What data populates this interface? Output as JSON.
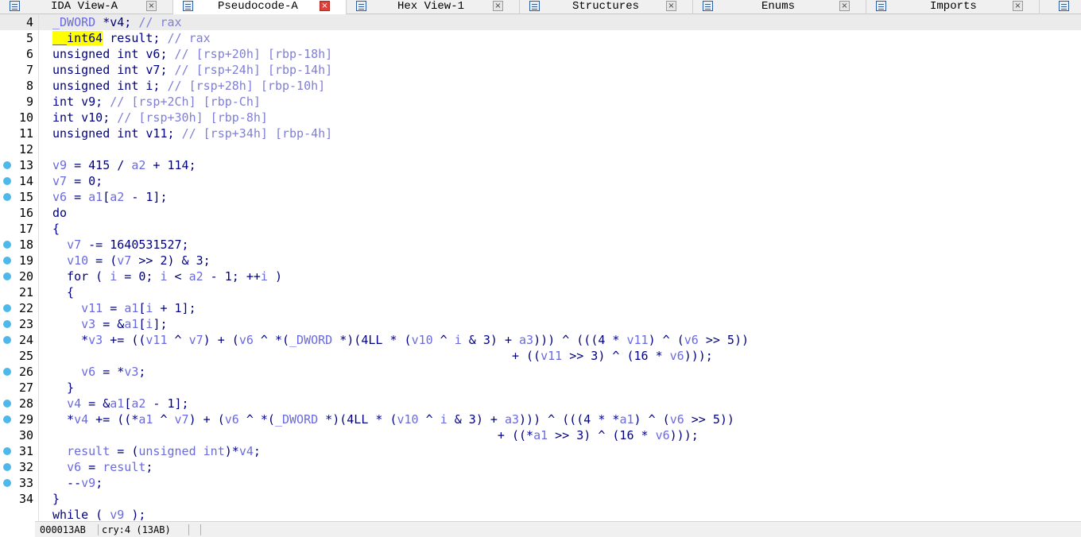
{
  "tabs": [
    {
      "label": "IDA View-A",
      "active": false,
      "icon": "listing-icon"
    },
    {
      "label": "Pseudocode-A",
      "active": true,
      "icon": "pseudocode-icon"
    },
    {
      "label": "Hex View-1",
      "active": false,
      "icon": "hex-icon"
    },
    {
      "label": "Structures",
      "active": false,
      "icon": "structures-icon"
    },
    {
      "label": "Enums",
      "active": false,
      "icon": "enums-icon"
    },
    {
      "label": "Imports",
      "active": false,
      "icon": "imports-icon"
    },
    {
      "label": "",
      "active": false,
      "icon": "exports-icon"
    }
  ],
  "code_lines": [
    {
      "num": "4",
      "bp": false,
      "tokens": [
        [
          "var",
          "_DWORD "
        ],
        [
          "kw",
          "*v4; "
        ],
        [
          "cmt",
          "// rax"
        ]
      ]
    },
    {
      "num": "5",
      "bp": false,
      "tokens": [
        [
          "hl",
          "__int64"
        ],
        [
          "kw",
          " result; "
        ],
        [
          "cmt",
          "// rax"
        ]
      ]
    },
    {
      "num": "6",
      "bp": false,
      "tokens": [
        [
          "kw",
          "unsigned int v6; "
        ],
        [
          "cmt",
          "// [rsp+20h] [rbp-18h]"
        ]
      ]
    },
    {
      "num": "7",
      "bp": false,
      "tokens": [
        [
          "kw",
          "unsigned int v7; "
        ],
        [
          "cmt",
          "// [rsp+24h] [rbp-14h]"
        ]
      ]
    },
    {
      "num": "8",
      "bp": false,
      "tokens": [
        [
          "kw",
          "unsigned int i; "
        ],
        [
          "cmt",
          "// [rsp+28h] [rbp-10h]"
        ]
      ]
    },
    {
      "num": "9",
      "bp": false,
      "tokens": [
        [
          "kw",
          "int v9; "
        ],
        [
          "cmt",
          "// [rsp+2Ch] [rbp-Ch]"
        ]
      ]
    },
    {
      "num": "10",
      "bp": false,
      "tokens": [
        [
          "kw",
          "int v10; "
        ],
        [
          "cmt",
          "// [rsp+30h] [rbp-8h]"
        ]
      ]
    },
    {
      "num": "11",
      "bp": false,
      "tokens": [
        [
          "kw",
          "unsigned int v11; "
        ],
        [
          "cmt",
          "// [rsp+34h] [rbp-4h]"
        ]
      ]
    },
    {
      "num": "12",
      "bp": false,
      "tokens": []
    },
    {
      "num": "13",
      "bp": true,
      "tokens": [
        [
          "var",
          "v9"
        ],
        [
          "kw",
          " = 415 / "
        ],
        [
          "var",
          "a2"
        ],
        [
          "kw",
          " + 114;"
        ]
      ]
    },
    {
      "num": "14",
      "bp": true,
      "tokens": [
        [
          "var",
          "v7"
        ],
        [
          "kw",
          " = 0;"
        ]
      ]
    },
    {
      "num": "15",
      "bp": true,
      "tokens": [
        [
          "var",
          "v6"
        ],
        [
          "kw",
          " = "
        ],
        [
          "var",
          "a1"
        ],
        [
          "kw",
          "["
        ],
        [
          "var",
          "a2"
        ],
        [
          "kw",
          " - 1];"
        ]
      ]
    },
    {
      "num": "16",
      "bp": false,
      "tokens": [
        [
          "kw",
          "do"
        ]
      ]
    },
    {
      "num": "17",
      "bp": false,
      "tokens": [
        [
          "kw",
          "{"
        ]
      ]
    },
    {
      "num": "18",
      "bp": true,
      "tokens": [
        [
          "kw",
          "  "
        ],
        [
          "var",
          "v7"
        ],
        [
          "kw",
          " -= 1640531527;"
        ]
      ]
    },
    {
      "num": "19",
      "bp": true,
      "tokens": [
        [
          "kw",
          "  "
        ],
        [
          "var",
          "v10"
        ],
        [
          "kw",
          " = ("
        ],
        [
          "var",
          "v7"
        ],
        [
          "kw",
          " >> 2) & 3;"
        ]
      ]
    },
    {
      "num": "20",
      "bp": true,
      "tokens": [
        [
          "kw",
          "  for ( "
        ],
        [
          "var",
          "i"
        ],
        [
          "kw",
          " = 0; "
        ],
        [
          "var",
          "i"
        ],
        [
          "kw",
          " < "
        ],
        [
          "var",
          "a2"
        ],
        [
          "kw",
          " - 1; ++"
        ],
        [
          "var",
          "i"
        ],
        [
          "kw",
          " )"
        ]
      ]
    },
    {
      "num": "21",
      "bp": false,
      "tokens": [
        [
          "kw",
          "  {"
        ]
      ]
    },
    {
      "num": "22",
      "bp": true,
      "tokens": [
        [
          "kw",
          "    "
        ],
        [
          "var",
          "v11"
        ],
        [
          "kw",
          " = "
        ],
        [
          "var",
          "a1"
        ],
        [
          "kw",
          "["
        ],
        [
          "var",
          "i"
        ],
        [
          "kw",
          " + 1];"
        ]
      ]
    },
    {
      "num": "23",
      "bp": true,
      "tokens": [
        [
          "kw",
          "    "
        ],
        [
          "var",
          "v3"
        ],
        [
          "kw",
          " = &"
        ],
        [
          "var",
          "a1"
        ],
        [
          "kw",
          "["
        ],
        [
          "var",
          "i"
        ],
        [
          "kw",
          "];"
        ]
      ]
    },
    {
      "num": "24",
      "bp": true,
      "tokens": [
        [
          "kw",
          "    *"
        ],
        [
          "var",
          "v3"
        ],
        [
          "kw",
          " += (("
        ],
        [
          "var",
          "v11"
        ],
        [
          "kw",
          " ^ "
        ],
        [
          "var",
          "v7"
        ],
        [
          "kw",
          ") + ("
        ],
        [
          "var",
          "v6"
        ],
        [
          "kw",
          " ^ *("
        ],
        [
          "var",
          "_DWORD"
        ],
        [
          "kw",
          " *)(4LL * ("
        ],
        [
          "var",
          "v10"
        ],
        [
          "kw",
          " ^ "
        ],
        [
          "var",
          "i"
        ],
        [
          "kw",
          " & 3) + "
        ],
        [
          "var",
          "a3"
        ],
        [
          "kw",
          "))) ^ (((4 * "
        ],
        [
          "var",
          "v11"
        ],
        [
          "kw",
          ") ^ ("
        ],
        [
          "var",
          "v6"
        ],
        [
          "kw",
          " >> 5))"
        ]
      ]
    },
    {
      "num": "25",
      "bp": false,
      "tokens": [
        [
          "kw",
          "                                                                + (("
        ],
        [
          "var",
          "v11"
        ],
        [
          "kw",
          " >> 3) ^ (16 * "
        ],
        [
          "var",
          "v6"
        ],
        [
          "kw",
          ")));"
        ]
      ]
    },
    {
      "num": "26",
      "bp": true,
      "tokens": [
        [
          "kw",
          "    "
        ],
        [
          "var",
          "v6"
        ],
        [
          "kw",
          " = *"
        ],
        [
          "var",
          "v3"
        ],
        [
          "kw",
          ";"
        ]
      ]
    },
    {
      "num": "27",
      "bp": false,
      "tokens": [
        [
          "kw",
          "  }"
        ]
      ]
    },
    {
      "num": "28",
      "bp": true,
      "tokens": [
        [
          "kw",
          "  "
        ],
        [
          "var",
          "v4"
        ],
        [
          "kw",
          " = &"
        ],
        [
          "var",
          "a1"
        ],
        [
          "kw",
          "["
        ],
        [
          "var",
          "a2"
        ],
        [
          "kw",
          " - 1];"
        ]
      ]
    },
    {
      "num": "29",
      "bp": true,
      "tokens": [
        [
          "kw",
          "  *"
        ],
        [
          "var",
          "v4"
        ],
        [
          "kw",
          " += ((*"
        ],
        [
          "var",
          "a1"
        ],
        [
          "kw",
          " ^ "
        ],
        [
          "var",
          "v7"
        ],
        [
          "kw",
          ") + ("
        ],
        [
          "var",
          "v6"
        ],
        [
          "kw",
          " ^ *("
        ],
        [
          "var",
          "_DWORD"
        ],
        [
          "kw",
          " *)(4LL * ("
        ],
        [
          "var",
          "v10"
        ],
        [
          "kw",
          " ^ "
        ],
        [
          "var",
          "i"
        ],
        [
          "kw",
          " & 3) + "
        ],
        [
          "var",
          "a3"
        ],
        [
          "kw",
          "))) ^ (((4 * *"
        ],
        [
          "var",
          "a1"
        ],
        [
          "kw",
          ") ^ ("
        ],
        [
          "var",
          "v6"
        ],
        [
          "kw",
          " >> 5))"
        ]
      ]
    },
    {
      "num": "30",
      "bp": false,
      "tokens": [
        [
          "kw",
          "                                                              + ((*"
        ],
        [
          "var",
          "a1"
        ],
        [
          "kw",
          " >> 3) ^ (16 * "
        ],
        [
          "var",
          "v6"
        ],
        [
          "kw",
          ")));"
        ]
      ]
    },
    {
      "num": "31",
      "bp": true,
      "tokens": [
        [
          "kw",
          "  "
        ],
        [
          "var",
          "result"
        ],
        [
          "kw",
          " = ("
        ],
        [
          "var",
          "unsigned int"
        ],
        [
          "kw",
          ")*"
        ],
        [
          "var",
          "v4"
        ],
        [
          "kw",
          ";"
        ]
      ]
    },
    {
      "num": "32",
      "bp": true,
      "tokens": [
        [
          "kw",
          "  "
        ],
        [
          "var",
          "v6"
        ],
        [
          "kw",
          " = "
        ],
        [
          "var",
          "result"
        ],
        [
          "kw",
          ";"
        ]
      ]
    },
    {
      "num": "33",
      "bp": true,
      "tokens": [
        [
          "kw",
          "  --"
        ],
        [
          "var",
          "v9"
        ],
        [
          "kw",
          ";"
        ]
      ]
    },
    {
      "num": "34",
      "bp": false,
      "tokens": [
        [
          "kw",
          "}"
        ]
      ]
    },
    {
      "num": "",
      "bp": false,
      "tokens": [
        [
          "kw",
          "while ( "
        ],
        [
          "var",
          "v9"
        ],
        [
          "kw",
          " );"
        ]
      ]
    }
  ],
  "status": {
    "address": "000013AB",
    "location": "cry:4 (13AB)"
  },
  "colors": {
    "breakpoint": "#4fb8ea",
    "highlight": "#ffff00",
    "keyword": "#000080",
    "variable": "#6a6ae0",
    "comment": "#7f7fd6"
  }
}
